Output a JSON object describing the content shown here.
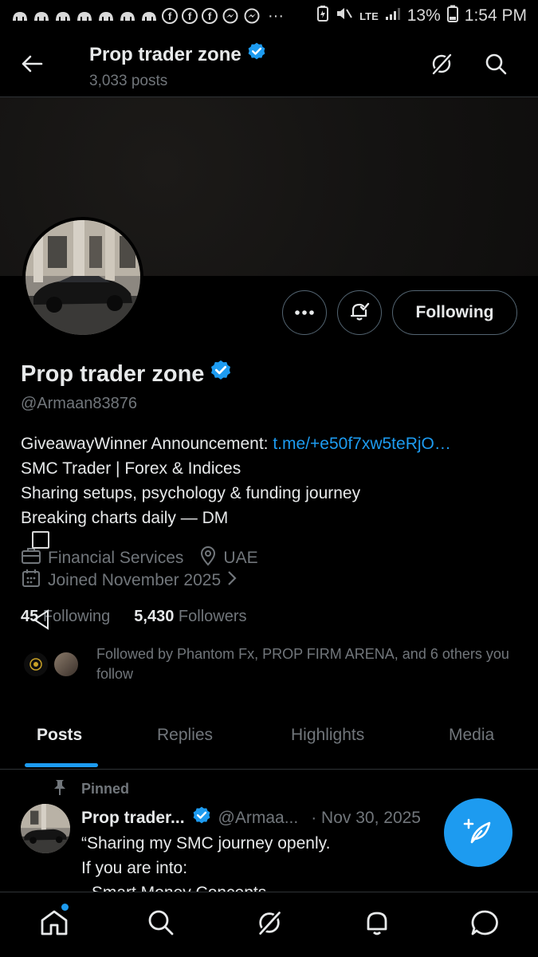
{
  "status_bar": {
    "more": "···",
    "network": "LTE",
    "battery": "13%",
    "time": "1:54 PM"
  },
  "header": {
    "title": "Prop trader zone",
    "posts_count": "3,033 posts"
  },
  "profile": {
    "name": "Prop trader zone",
    "handle": "@Armaan83876",
    "following_button": "Following",
    "bio_line1_text": "GiveawayWinner Announcement: ",
    "bio_link": "t.me/+e50f7xw5teRjO…",
    "bio_line2": "SMC Trader | Forex & Indices",
    "bio_line3": "Sharing setups, psychology & funding journey",
    "bio_line4": "Breaking charts daily — DM",
    "category": "Financial Services",
    "location": "UAE",
    "joined": "Joined November 2025",
    "following_count": "45",
    "following_label": "Following",
    "followers_count": "5,430",
    "followers_label": "Followers",
    "followed_by": "Followed by Phantom Fx, PROP FIRM ARENA, and 6 others you follow"
  },
  "tabs": [
    "Posts",
    "Replies",
    "Highlights",
    "Media"
  ],
  "post": {
    "pinned_label": "Pinned",
    "author": "Prop trader...",
    "handle": "@Armaa...",
    "date": "· Nov 30, 2025",
    "line1": "“Sharing my SMC journey openly.",
    "line2": "If you are into:",
    "line3": "- Smart Money Concepts"
  },
  "colors": {
    "accent": "#1d9bf0",
    "background": "#000000",
    "secondary_text": "#71767b",
    "primary_text": "#e7e9ea"
  },
  "icons": {
    "back": "arrow-left-icon",
    "grok": "grok-icon",
    "search": "search-icon",
    "verified": "verified-badge-icon",
    "more": "more-dots-icon",
    "notify": "bell-check-icon",
    "category": "briefcase-icon",
    "location": "location-pin-icon",
    "calendar": "calendar-icon",
    "compose": "compose-feather-icon",
    "home": "home-icon",
    "notifications": "bell-icon",
    "messages": "chat-bubble-icon"
  }
}
